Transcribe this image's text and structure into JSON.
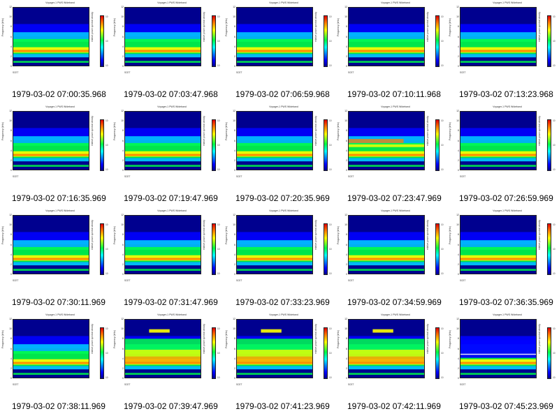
{
  "panels": [
    {
      "timestamp": "1979-03-02 07:00:35.968",
      "variant": "normal"
    },
    {
      "timestamp": "1979-03-02 07:03:47.968",
      "variant": "normal"
    },
    {
      "timestamp": "1979-03-02 07:06:59.968",
      "variant": "normal"
    },
    {
      "timestamp": "1979-03-02 07:10:11.968",
      "variant": "normal"
    },
    {
      "timestamp": "1979-03-02 07:13:23.968",
      "variant": "normal"
    },
    {
      "timestamp": "1979-03-02 07:16:35.969",
      "variant": "normal"
    },
    {
      "timestamp": "1979-03-02 07:19:47.969",
      "variant": "normal"
    },
    {
      "timestamp": "1979-03-02 07:20:35.969",
      "variant": "normal"
    },
    {
      "timestamp": "1979-03-02 07:23:47.969",
      "variant": "band"
    },
    {
      "timestamp": "1979-03-02 07:26:59.969",
      "variant": "normal"
    },
    {
      "timestamp": "1979-03-02 07:30:11.969",
      "variant": "normal"
    },
    {
      "timestamp": "1979-03-02 07:31:47.969",
      "variant": "normal"
    },
    {
      "timestamp": "1979-03-02 07:33:23.969",
      "variant": "normal"
    },
    {
      "timestamp": "1979-03-02 07:34:59.969",
      "variant": "normal"
    },
    {
      "timestamp": "1979-03-02 07:36:35.969",
      "variant": "normal"
    },
    {
      "timestamp": "1979-03-02 07:38:11.969",
      "variant": "normal"
    },
    {
      "timestamp": "1979-03-02 07:39:47.969",
      "variant": "bright"
    },
    {
      "timestamp": "1979-03-02 07:41:23.969",
      "variant": "bright"
    },
    {
      "timestamp": "1979-03-02 07:42:11.969",
      "variant": "bright"
    },
    {
      "timestamp": "1979-03-02 07:45:23.969",
      "variant": "line"
    }
  ],
  "plot_labels": {
    "title": "Voyager-1 PWS Wideband",
    "ylabel": "Frequency (kHz)",
    "colorbar_label": "relative power spectral density",
    "yticks": [
      "12",
      "10",
      "8",
      "6",
      "4",
      "2",
      "0"
    ],
    "cbar_ticks": [
      "10",
      "10",
      "10"
    ],
    "scet": "SCET"
  },
  "colors": {
    "background": "#00008f",
    "noise": "#0000ff",
    "mid": "#00d0ff",
    "green": "#00ff44",
    "yellow": "#ffff00",
    "orange": "#ff8000",
    "red": "#e00000"
  }
}
